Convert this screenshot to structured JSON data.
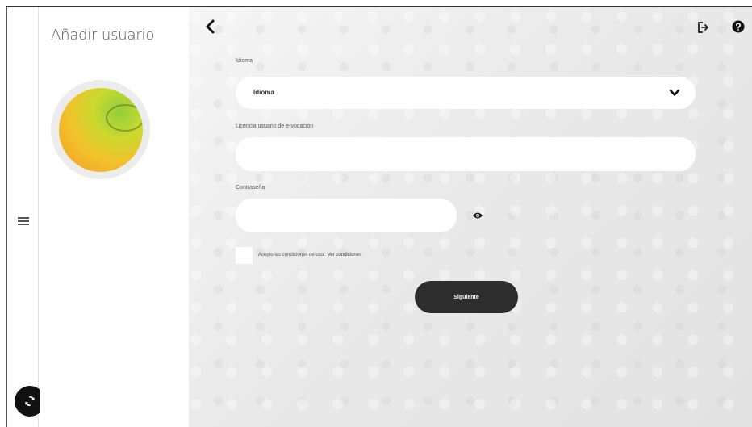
{
  "profile": {
    "title": "Añadir usuario"
  },
  "rail": {
    "menu_icon": "hamburger-menu-icon",
    "sync_icon": "sync-icon"
  },
  "header": {
    "back_icon": "chevron-left-icon",
    "logout_icon": "logout-icon",
    "help_icon": "help-icon"
  },
  "form": {
    "language": {
      "label": "Idioma",
      "value": "Idioma"
    },
    "username": {
      "label": "Licencia usuario de e-vocación",
      "value": ""
    },
    "password": {
      "label": "Contraseña",
      "value": ""
    },
    "terms": {
      "text": "Acepto las condiciones de uso.",
      "link": "Ver condiciones",
      "checked": false
    },
    "next_label": "Siguiente"
  },
  "colors": {
    "primary_button": "#2d2d2d",
    "background": "#e9e9e9",
    "avatar_gradient": [
      "#8fcf3a",
      "#f2c12b",
      "#f39a26"
    ]
  }
}
